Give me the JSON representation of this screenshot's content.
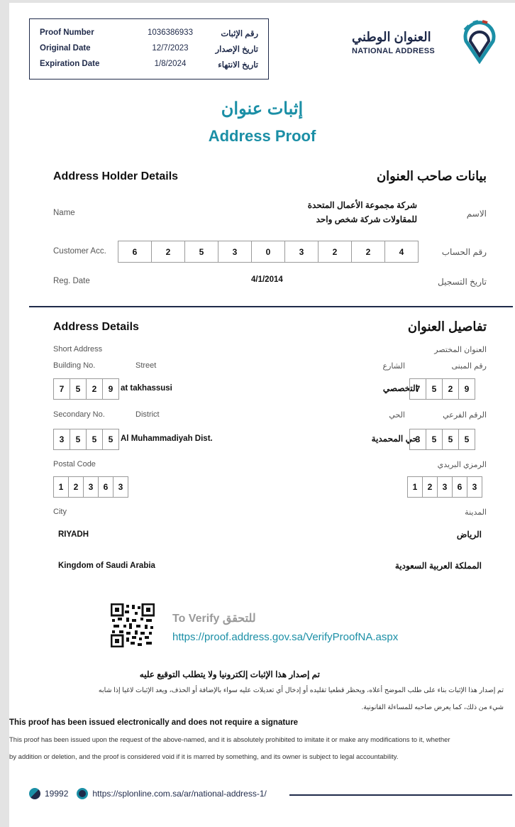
{
  "proof_box": {
    "rows": [
      {
        "en": "Proof Number",
        "value": "1036386933",
        "ar": "رقم الإثبات"
      },
      {
        "en": "Original Date",
        "value": "12/7/2023",
        "ar": "تاريخ الإصدار"
      },
      {
        "en": "Expiration Date",
        "value": "1/8/2024",
        "ar": "تاريخ الانتهاء"
      }
    ]
  },
  "logo": {
    "ar": "العنوان الوطني",
    "en": "NATIONAL ADDRESS"
  },
  "title": {
    "ar": "إثبات عنوان",
    "en": "Address Proof"
  },
  "holder": {
    "heading_en": "Address Holder Details",
    "heading_ar": "بيانات صاحب العنوان",
    "name_label_en": "Name",
    "name_label_ar": "الاسم",
    "name_line1": "شركة مجموعة الأعمال المتحدة",
    "name_line2": "للمقاولات شركة شخص واحد",
    "acc_label_en": "Customer Acc.",
    "acc_label_ar": "رقم الحساب",
    "acc_digits": [
      "6",
      "2",
      "5",
      "3",
      "0",
      "3",
      "2",
      "2",
      "4"
    ],
    "reg_label_en": "Reg. Date",
    "reg_label_ar": "تاريخ التسجيل",
    "reg_date": "4/1/2014"
  },
  "address": {
    "heading_en": "Address Details",
    "heading_ar": "تفاصيل العنوان",
    "short_en": "Short Address",
    "short_ar": "العنوان المختصر",
    "building_en": "Building No.",
    "street_en": "Street",
    "street_ar": "الشارع",
    "building_ar": "رقم المبنى",
    "building_digits_en": [
      "7",
      "5",
      "2",
      "9"
    ],
    "building_digits_ar": [
      "7",
      "5",
      "2",
      "9"
    ],
    "street_value_en": "at takhassusi",
    "street_value_ar": "التخصصي",
    "secondary_en": "Secondary No.",
    "district_en": "District",
    "district_ar": "الحي",
    "secondary_ar": "الرقم الفرعي",
    "secondary_digits_en": [
      "3",
      "5",
      "5",
      "5"
    ],
    "secondary_digits_ar": [
      "3",
      "5",
      "5",
      "5"
    ],
    "district_value_en": "Al Muhammadiyah Dist.",
    "district_value_ar": "حي المحمدية",
    "postal_en": "Postal Code",
    "postal_ar": "الرمزي البريدي",
    "postal_digits_en": [
      "1",
      "2",
      "3",
      "6",
      "3"
    ],
    "postal_digits_ar": [
      "1",
      "2",
      "3",
      "6",
      "3"
    ],
    "city_en": "City",
    "city_ar": "المدينة",
    "city_value_en": "RIYADH",
    "city_value_ar": "الرياض",
    "country_en": "Kingdom of Saudi Arabia",
    "country_ar": "المملكة العربية السعودية"
  },
  "verify": {
    "label": "To Verify للتحقق",
    "url": "https://proof.address.gov.sa/VerifyProofNA.aspx"
  },
  "notes": {
    "title_ar": "تم إصدار هذا الإثبات إلكترونيا ولا يتطلب التوقيع عليه",
    "body_ar_1": "تم إصدار هذا الإثبات بناء على طلب الموضح أعلاه، ويحظر قطعيا تقليده أو إدخال أي تعديلات عليه سواء بالإضافة أو الحذف، ويعد الإثبات لاغيا إذا شابه",
    "body_ar_2": "شيء من ذلك، كما يعرض صاحبه للمساءلة القانونية.",
    "title_en": "This proof has been issued electronically and does not require a signature",
    "body_en_1": "This proof has been issued upon the request of the above-named, and it is absolutely prohibited to imitate it or make any modifications to it, whether",
    "body_en_2": "by addition or deletion, and the proof is considered void if it is marred by something, and its owner is subject to legal accountability."
  },
  "footer": {
    "phone": "19992",
    "url": "https://splonline.com.sa/ar/national-address-1/"
  },
  "colors": {
    "navy": "#1f2a4a",
    "teal": "#1b8fa6"
  }
}
